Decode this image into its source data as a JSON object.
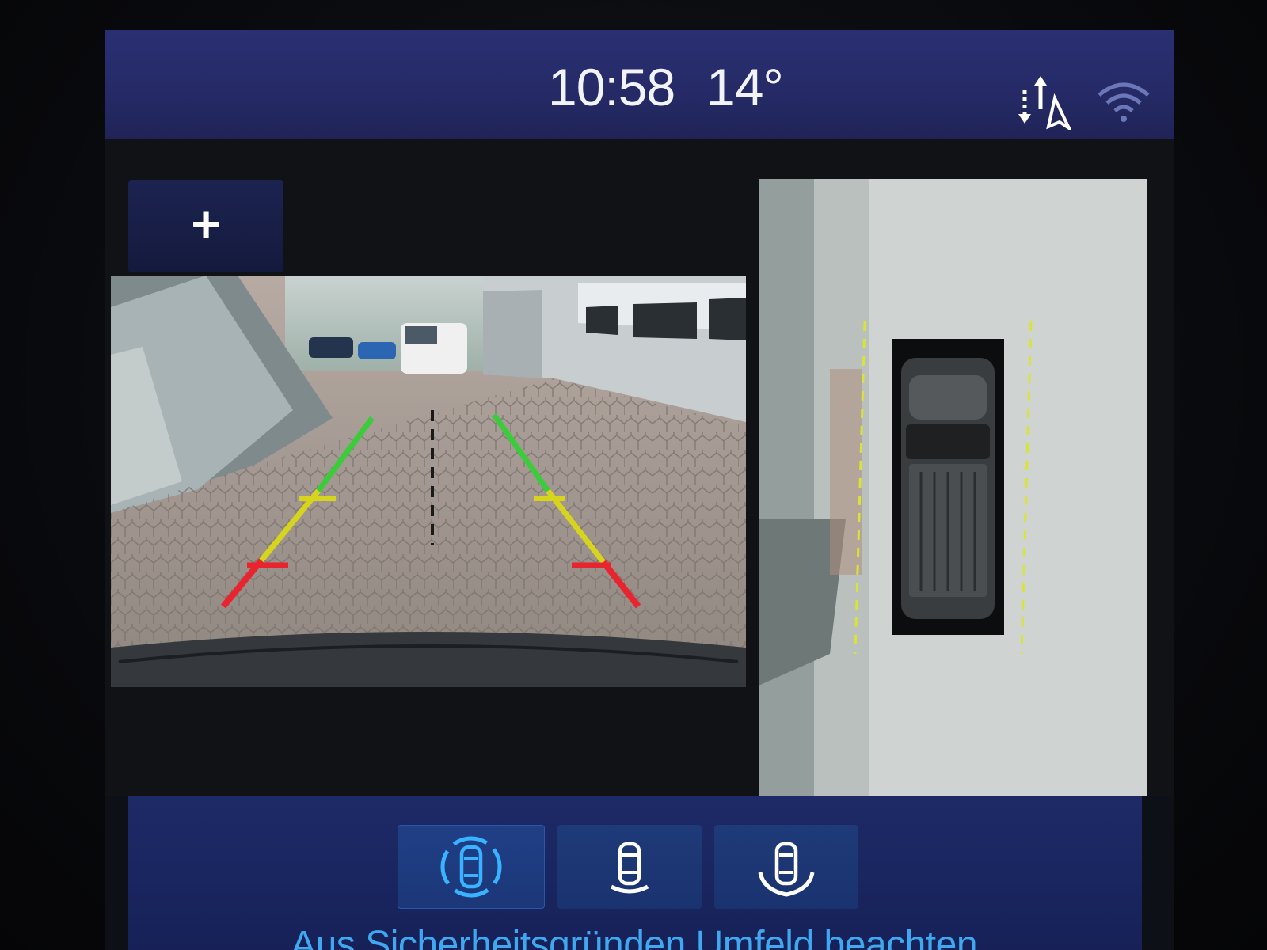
{
  "status_bar": {
    "time": "10:58",
    "temperature": "14°",
    "icons": [
      "navigation-arrows-icon",
      "wifi-icon"
    ]
  },
  "camera": {
    "zoom_button_label": "+",
    "guide_line_colors": {
      "near": "#e8242f",
      "mid": "#e0d21c",
      "far": "#39c43a"
    },
    "top_view_guide_color": "#d8e436"
  },
  "view_buttons": [
    {
      "icon": "car-all-around-view-icon",
      "active": true
    },
    {
      "icon": "car-rear-view-icon",
      "active": false
    },
    {
      "icon": "car-rear-wide-view-icon",
      "active": false
    }
  ],
  "message": "Aus Sicherheitsgründen Umfeld beachten.",
  "colors": {
    "accent": "#3fa8f0",
    "status_bar": "#252a66",
    "control_bar": "#1a2660"
  }
}
